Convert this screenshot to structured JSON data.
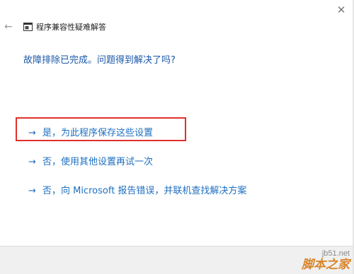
{
  "window": {
    "close_glyph": "✕"
  },
  "header": {
    "back_glyph": "←",
    "title": "程序兼容性疑难解答"
  },
  "main": {
    "question": "故障排除已完成。问题得到解决了吗?",
    "options": [
      {
        "arrow": "→",
        "label": "是，为此程序保存这些设置"
      },
      {
        "arrow": "→",
        "label": "否，使用其他设置再试一次"
      },
      {
        "arrow": "→",
        "label": "否，向 Microsoft 报告错误，并联机查找解决方案"
      }
    ]
  },
  "watermark": {
    "site": "jb51.net",
    "brand": "脚本之家"
  },
  "colors": {
    "link": "#1d6fc0",
    "heading": "#1a57a8",
    "highlight": "#e0302c"
  }
}
